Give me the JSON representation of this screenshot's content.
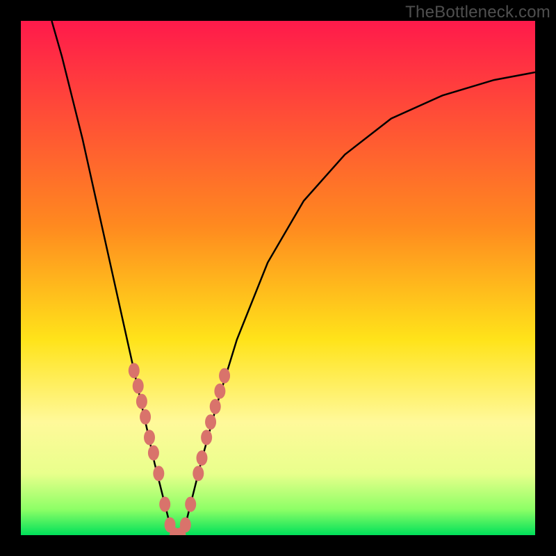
{
  "watermark": {
    "text": "TheBottleneck.com"
  },
  "chart_data": {
    "type": "line",
    "title": "",
    "xlabel": "",
    "ylabel": "",
    "xlim": [
      0,
      100
    ],
    "ylim": [
      0,
      100
    ],
    "grid": false,
    "legend": false,
    "background_gradient_stops": [
      {
        "offset": 0,
        "color": "#ff1a4b"
      },
      {
        "offset": 40,
        "color": "#ff8a1f"
      },
      {
        "offset": 62,
        "color": "#ffe31a"
      },
      {
        "offset": 78,
        "color": "#fff99a"
      },
      {
        "offset": 88,
        "color": "#e9ff8c"
      },
      {
        "offset": 95,
        "color": "#8dff66"
      },
      {
        "offset": 100,
        "color": "#00e05a"
      }
    ],
    "series": [
      {
        "name": "bottleneck-curve",
        "type": "line",
        "color": "#000000",
        "x": [
          6,
          8,
          10,
          12,
          14,
          16,
          18,
          20,
          22,
          24,
          26,
          28,
          29,
          30,
          31,
          32,
          33,
          35,
          38,
          42,
          48,
          55,
          63,
          72,
          82,
          92,
          100
        ],
        "y": [
          100,
          93,
          85,
          77,
          68,
          59,
          50,
          41,
          32,
          23,
          14,
          6,
          2,
          0,
          0,
          2,
          6,
          14,
          25,
          38,
          53,
          65,
          74,
          81,
          85.5,
          88.5,
          90
        ]
      },
      {
        "name": "data-points",
        "type": "scatter",
        "color": "#d9736b",
        "x": [
          22.0,
          22.8,
          23.5,
          24.2,
          25.0,
          25.8,
          26.8,
          28.0,
          29.0,
          30.0,
          31.0,
          32.0,
          33.0,
          34.5,
          35.2,
          36.1,
          36.9,
          37.8,
          38.7,
          39.6
        ],
        "y": [
          32,
          29,
          26,
          23,
          19,
          16,
          12,
          6,
          2,
          0,
          0,
          2,
          6,
          12,
          15,
          19,
          22,
          25,
          28,
          31
        ]
      }
    ]
  }
}
